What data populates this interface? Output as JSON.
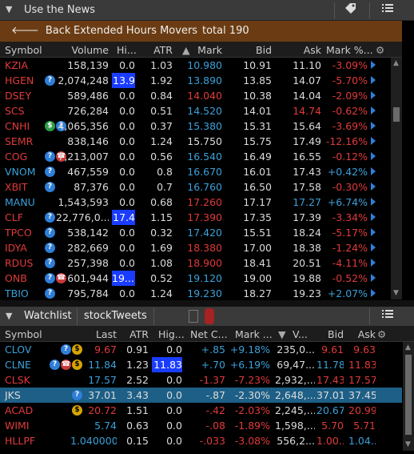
{
  "titlebar": {
    "title": "Use the News",
    "tag_icon": "tag-icon",
    "menu_icon": "menu-icon",
    "collapse_icon": "chevron-down-icon"
  },
  "navbar": {
    "back_label": "Back",
    "title": "Extended Hours Movers",
    "total": "total 190"
  },
  "movers": {
    "columns": {
      "symbol": "Symbol",
      "volume": "Volume",
      "high": "Hi...",
      "atr": "ATR",
      "mark": "Mark",
      "bid": "Bid",
      "ask": "Ask",
      "markpct": "Mark %..."
    },
    "rows": [
      {
        "sym": "KZIA",
        "vol": "158,139",
        "hi": "0.0",
        "atr": "1.03",
        "mark": "10.980",
        "bid": "10.91",
        "ask": "11.10",
        "pct": "-3.09%",
        "dir": "dn",
        "markdir": "up",
        "askdir": "wh",
        "icons": [],
        "hihl": false
      },
      {
        "sym": "HGEN",
        "vol": "2,074,248",
        "hi": "13.9",
        "atr": "1.92",
        "mark": "13.890",
        "bid": "13.85",
        "ask": "14.07",
        "pct": "-5.70%",
        "dir": "dn",
        "markdir": "up",
        "askdir": "wh",
        "icons": [
          "q"
        ],
        "hihl": true
      },
      {
        "sym": "DSEY",
        "vol": "589,486",
        "hi": "0.0",
        "atr": "0.84",
        "mark": "14.040",
        "bid": "10.38",
        "ask": "14.04",
        "pct": "-2.09%",
        "dir": "dn",
        "markdir": "dn",
        "askdir": "wh",
        "icons": [],
        "hihl": false
      },
      {
        "sym": "SCS",
        "vol": "726,284",
        "hi": "0.0",
        "atr": "0.51",
        "mark": "14.520",
        "bid": "14.01",
        "ask": "14.74",
        "pct": "-0.62%",
        "dir": "dn",
        "markdir": "up",
        "askdir": "dn",
        "icons": [],
        "hihl": false
      },
      {
        "sym": "CNHI",
        "vol": "4,065,356",
        "hi": "0.0",
        "atr": "0.37",
        "mark": "15.380",
        "bid": "15.31",
        "ask": "15.64",
        "pct": "-3.69%",
        "dir": "dn",
        "markdir": "up",
        "askdir": "wh",
        "icons": [
          "e",
          "q"
        ],
        "hihl": false
      },
      {
        "sym": "SEMR",
        "vol": "838,146",
        "hi": "0.0",
        "atr": "1.24",
        "mark": "15.750",
        "bid": "15.75",
        "ask": "17.49",
        "pct": "-12.16%",
        "dir": "dn",
        "markdir": "wh",
        "askdir": "wh",
        "icons": [],
        "hihl": false
      },
      {
        "sym": "COG",
        "vol": "7,213,007",
        "hi": "0.0",
        "atr": "0.56",
        "mark": "16.540",
        "bid": "16.49",
        "ask": "16.55",
        "pct": "-0.12%",
        "dir": "dn",
        "markdir": "up",
        "askdir": "wh",
        "icons": [
          "q",
          "ph"
        ],
        "hihl": false
      },
      {
        "sym": "VNOM",
        "vol": "467,559",
        "hi": "0.0",
        "atr": "0.8",
        "mark": "16.670",
        "bid": "16.01",
        "ask": "17.43",
        "pct": "+0.42%",
        "dir": "up",
        "markdir": "up",
        "askdir": "wh",
        "icons": [
          "q"
        ],
        "hihl": false
      },
      {
        "sym": "XBIT",
        "vol": "87,376",
        "hi": "0.0",
        "atr": "0.7",
        "mark": "16.760",
        "bid": "16.50",
        "ask": "17.58",
        "pct": "-0.30%",
        "dir": "dn",
        "markdir": "up",
        "askdir": "wh",
        "icons": [
          "q"
        ],
        "hihl": false
      },
      {
        "sym": "MANU",
        "vol": "1,543,593",
        "hi": "0.0",
        "atr": "0.68",
        "mark": "17.260",
        "bid": "17.17",
        "ask": "17.27",
        "pct": "+6.74%",
        "dir": "up",
        "markdir": "dn",
        "askdir": "up",
        "icons": [],
        "hihl": false
      },
      {
        "sym": "CLF",
        "vol": "22,776,0...",
        "hi": "17.4",
        "atr": "1.15",
        "mark": "17.390",
        "bid": "17.35",
        "ask": "17.39",
        "pct": "-3.34%",
        "dir": "dn",
        "markdir": "dn",
        "askdir": "wh",
        "icons": [
          "q"
        ],
        "hihl": true
      },
      {
        "sym": "TPCO",
        "vol": "538,142",
        "hi": "0.0",
        "atr": "0.32",
        "mark": "17.420",
        "bid": "15.51",
        "ask": "18.24",
        "pct": "-5.17%",
        "dir": "dn",
        "markdir": "up",
        "askdir": "wh",
        "icons": [
          "q"
        ],
        "hihl": false
      },
      {
        "sym": "IDYA",
        "vol": "282,669",
        "hi": "0.0",
        "atr": "1.69",
        "mark": "18.380",
        "bid": "17.00",
        "ask": "18.38",
        "pct": "-1.24%",
        "dir": "dn",
        "markdir": "dn",
        "askdir": "wh",
        "icons": [
          "q"
        ],
        "hihl": false
      },
      {
        "sym": "RDUS",
        "vol": "257,398",
        "hi": "0.0",
        "atr": "1.08",
        "mark": "18.900",
        "bid": "18.41",
        "ask": "20.51",
        "pct": "-4.11%",
        "dir": "dn",
        "markdir": "dn",
        "askdir": "wh",
        "icons": [
          "q"
        ],
        "hihl": false
      },
      {
        "sym": "ONB",
        "vol": "601,944",
        "hi": "19....",
        "atr": "0.52",
        "mark": "19.120",
        "bid": "19.00",
        "ask": "19.88",
        "pct": "-0.52%",
        "dir": "dn",
        "markdir": "up",
        "askdir": "wh",
        "icons": [
          "q",
          "ph"
        ],
        "hihl": true
      },
      {
        "sym": "TBIO",
        "vol": "795,784",
        "hi": "0.0",
        "atr": "1.24",
        "mark": "19.230",
        "bid": "18.27",
        "ask": "19.23",
        "pct": "+2.07%",
        "dir": "up",
        "markdir": "up",
        "askdir": "wh",
        "icons": [
          "q"
        ],
        "hihl": false
      }
    ]
  },
  "watchlist": {
    "title": "Watchlist",
    "name": "stockTweets",
    "columns": {
      "symbol": "Symbol",
      "last": "Last",
      "atr": "ATR",
      "high": "Hig...",
      "netc": "Net C...",
      "mark": "Mark ...",
      "vol": "V...",
      "bid": "Bid",
      "ask": "Ask"
    },
    "rows": [
      {
        "sym": "CLOV",
        "symc": "up",
        "last": "9.67",
        "lastc": "dn",
        "atr": "0.91",
        "hi": "0.0",
        "hihl": false,
        "net": "+.85",
        "netc": "up",
        "pct": "+9.18%",
        "vol": "235,0...",
        "bid": "9.61",
        "bidc": "dn",
        "ask": "9.63",
        "askc": "dn",
        "icons": [
          "q",
          "d"
        ],
        "selected": false
      },
      {
        "sym": "CLNE",
        "symc": "up",
        "last": "11.84",
        "lastc": "up",
        "atr": "1.23",
        "hi": "11.83",
        "hihl": true,
        "net": "+.70",
        "netc": "up",
        "pct": "+6.19%",
        "vol": "69,47...",
        "bid": "11.78",
        "bidc": "up",
        "ask": "11.83",
        "askc": "dn",
        "icons": [
          "q",
          "ph",
          "d"
        ],
        "selected": false
      },
      {
        "sym": "CLSK",
        "symc": "dn",
        "last": "17.57",
        "lastc": "up",
        "atr": "2.52",
        "hi": "0.0",
        "hihl": false,
        "net": "-1.37",
        "netc": "dn",
        "pct": "-7.23%",
        "vol": "2,932,...",
        "bid": "17.43",
        "bidc": "dn",
        "ask": "17.57",
        "askc": "dn",
        "icons": [],
        "selected": false
      },
      {
        "sym": "JKS",
        "symc": "wh",
        "last": "37.01",
        "lastc": "wh",
        "atr": "3.43",
        "hi": "0.0",
        "hihl": false,
        "net": "-.87",
        "netc": "wh",
        "pct": "-2.30%",
        "vol": "2,648,...",
        "bid": "37.01",
        "bidc": "wh",
        "ask": "37.45",
        "askc": "wh",
        "icons": [
          "q"
        ],
        "selected": true
      },
      {
        "sym": "ACAD",
        "symc": "dn",
        "last": "20.72",
        "lastc": "dn",
        "atr": "1.51",
        "hi": "0.0",
        "hihl": false,
        "net": "-.42",
        "netc": "dn",
        "pct": "-2.03%",
        "vol": "2,245,...",
        "bid": "20.67",
        "bidc": "up",
        "ask": "20.99",
        "askc": "dn",
        "icons": [
          "d"
        ],
        "selected": false
      },
      {
        "sym": "WIMI",
        "symc": "dn",
        "last": "5.74",
        "lastc": "up",
        "atr": "0.63",
        "hi": "0.0",
        "hihl": false,
        "net": "-.08",
        "netc": "dn",
        "pct": "-1.89%",
        "vol": "1,598,...",
        "bid": "5.70",
        "bidc": "dn",
        "ask": "5.71",
        "askc": "dn",
        "icons": [],
        "selected": false
      },
      {
        "sym": "HLLPF",
        "symc": "dn",
        "last": "1.040000",
        "lastc": "up",
        "atr": "0.15",
        "hi": "0.0",
        "hihl": false,
        "net": "-.033",
        "netc": "dn",
        "pct": "-3.08%",
        "vol": "556,2...",
        "bid": "1.00...",
        "bidc": "dn",
        "ask": "1.04...",
        "askc": "up",
        "icons": [],
        "selected": false
      }
    ]
  }
}
